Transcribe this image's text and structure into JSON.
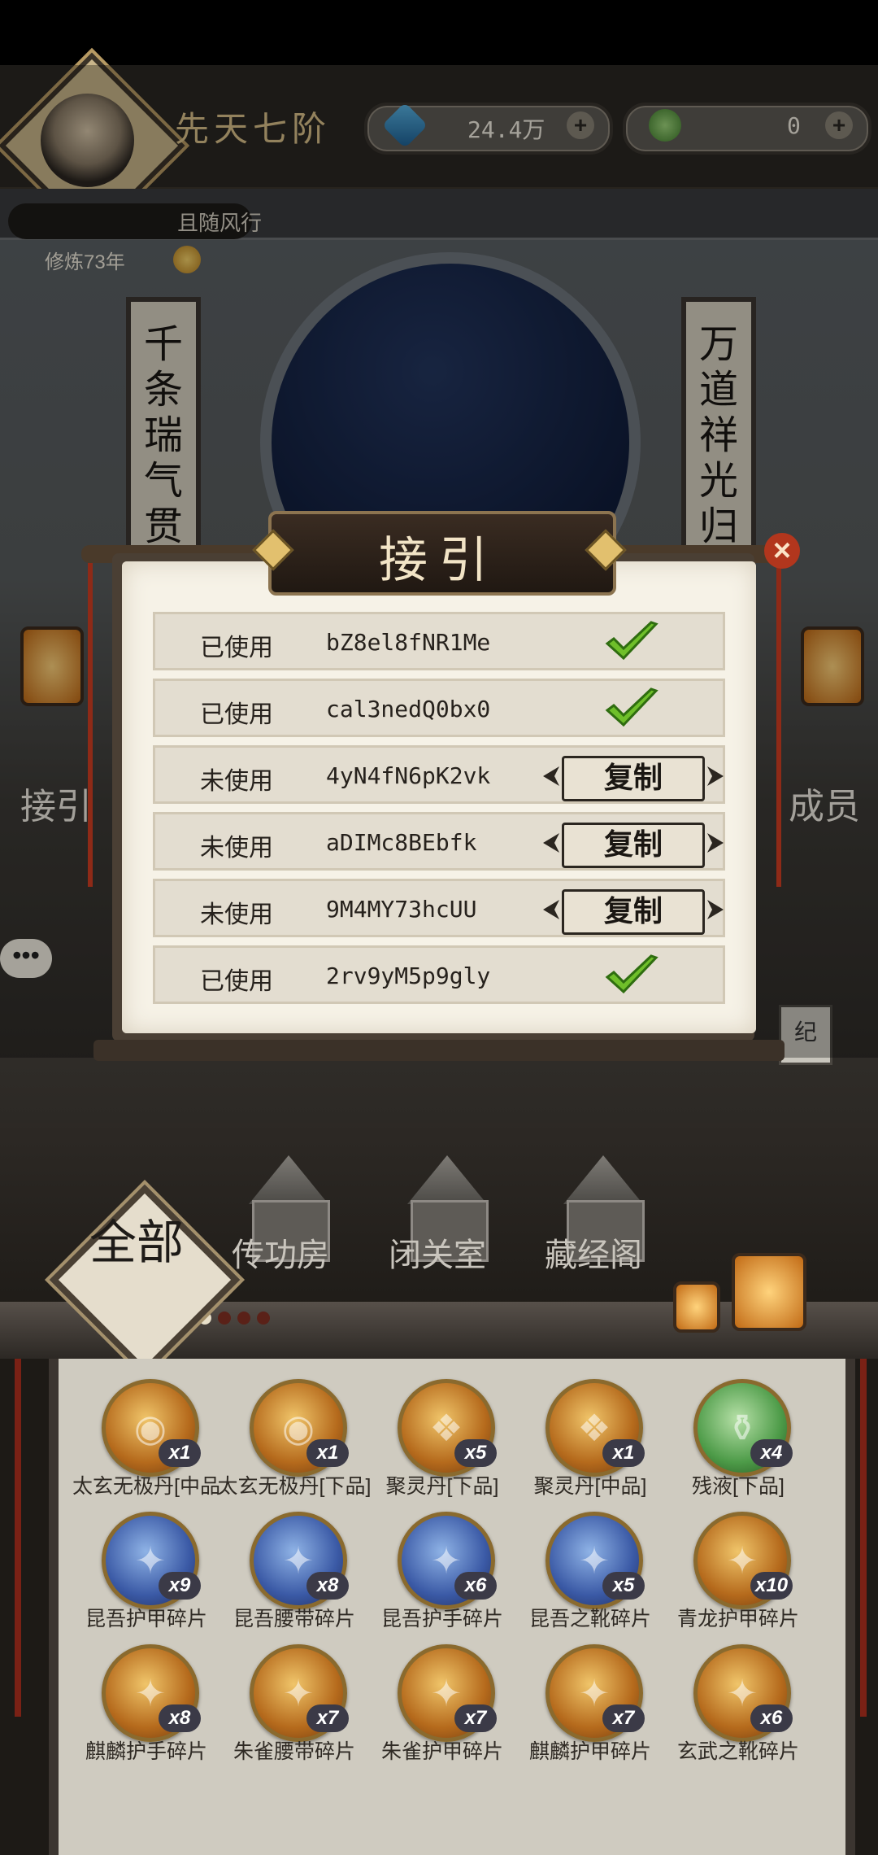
{
  "header": {
    "rank": "先天七阶",
    "spirit_stones": "24.4万",
    "jade": "0",
    "player_name": "且随风行",
    "cultivation": "修炼73年"
  },
  "scene": {
    "couplet_left": "千条瑞气贯",
    "couplet_right": "万道祥光归",
    "left_label": "接引",
    "right_label": "成员",
    "side_tab": "纪",
    "chat_bubble": "•••"
  },
  "dialog": {
    "title": "接引",
    "close": "×",
    "rows": [
      {
        "status": "已使用",
        "code": "bZ8el8fNR1Me",
        "used": true
      },
      {
        "status": "已使用",
        "code": "cal3nedQ0bx0",
        "used": true
      },
      {
        "status": "未使用",
        "code": "4yN4fN6pK2vk",
        "used": false,
        "action": "复制"
      },
      {
        "status": "未使用",
        "code": "aDIMc8BEbfk",
        "used": false,
        "action": "复制"
      },
      {
        "status": "未使用",
        "code": "9M4MY73hcUU",
        "used": false,
        "action": "复制"
      },
      {
        "status": "已使用",
        "code": "2rv9yM5p9gly",
        "used": true
      }
    ]
  },
  "buildings": {
    "all": "全部",
    "items": [
      "传功房",
      "闭关室",
      "藏经阁"
    ]
  },
  "inventory": {
    "items": [
      {
        "name": "太玄无极丹[中品",
        "count": "x1",
        "style": "gold",
        "icon": "pill-icon"
      },
      {
        "name": "太玄无极丹[下品]",
        "count": "x1",
        "style": "gold",
        "icon": "pill-icon"
      },
      {
        "name": "聚灵丹[下品]",
        "count": "x5",
        "style": "gold",
        "icon": "spirit-pill-icon"
      },
      {
        "name": "聚灵丹[中品]",
        "count": "x1",
        "style": "gold",
        "icon": "spirit-pill-icon"
      },
      {
        "name": "残液[下品]",
        "count": "x4",
        "style": "green",
        "icon": "flask-icon"
      },
      {
        "name": "昆吾护甲碎片",
        "count": "x9",
        "style": "blue",
        "icon": "armor-fragment-icon"
      },
      {
        "name": "昆吾腰带碎片",
        "count": "x8",
        "style": "blue",
        "icon": "belt-fragment-icon"
      },
      {
        "name": "昆吾护手碎片",
        "count": "x6",
        "style": "blue",
        "icon": "gauntlet-fragment-icon"
      },
      {
        "name": "昆吾之靴碎片",
        "count": "x5",
        "style": "blue",
        "icon": "boots-fragment-icon"
      },
      {
        "name": "青龙护甲碎片",
        "count": "x10",
        "style": "gold",
        "icon": "armor-fragment-icon"
      },
      {
        "name": "麒麟护手碎片",
        "count": "x8",
        "style": "gold",
        "icon": "gauntlet-fragment-icon"
      },
      {
        "name": "朱雀腰带碎片",
        "count": "x7",
        "style": "gold",
        "icon": "belt-fragment-icon"
      },
      {
        "name": "朱雀护甲碎片",
        "count": "x7",
        "style": "gold",
        "icon": "armor-fragment-icon"
      },
      {
        "name": "麒麟护甲碎片",
        "count": "x7",
        "style": "gold",
        "icon": "armor-fragment-icon"
      },
      {
        "name": "玄武之靴碎片",
        "count": "x6",
        "style": "gold",
        "icon": "boots-fragment-icon"
      }
    ]
  }
}
